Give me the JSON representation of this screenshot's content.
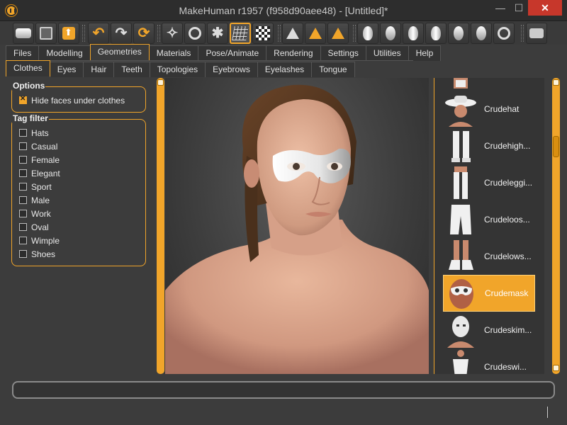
{
  "window": {
    "title": "MakeHuman r1957 (f958d90aee48) - [Untitled]*",
    "minimize_glyph": "—",
    "maximize_glyph": "☐",
    "close_glyph": "✕"
  },
  "toolbar": {
    "icons": [
      "wireframe-toggle-icon",
      "save-icon",
      "export-icon",
      "undo-icon",
      "redo-icon",
      "reset-icon",
      "smooth-icon",
      "wireframe-icon",
      "pose-icon",
      "grid-icon",
      "background-icon",
      "front-view-icon",
      "side-view-icon",
      "back-view-icon",
      "head-icon",
      "egg-icon",
      "face-icon",
      "skull-icon",
      "brain-icon",
      "lungs-icon",
      "ring-icon",
      "camera-icon"
    ],
    "active_icon": "grid-icon"
  },
  "tabs": [
    "Files",
    "Modelling",
    "Geometries",
    "Materials",
    "Pose/Animate",
    "Rendering",
    "Settings",
    "Utilities",
    "Help"
  ],
  "active_tab": "Geometries",
  "subtabs": [
    "Clothes",
    "Eyes",
    "Hair",
    "Teeth",
    "Topologies",
    "Eyebrows",
    "Eyelashes",
    "Tongue"
  ],
  "active_subtab": "Clothes",
  "options": {
    "title": "Options",
    "hide_faces_label": "Hide faces under clothes",
    "hide_faces_checked": true
  },
  "tag_filter": {
    "title": "Tag filter",
    "tags": [
      "Hats",
      "Casual",
      "Female",
      "Elegant",
      "Sport",
      "Male",
      "Work",
      "Oval",
      "Wimple",
      "Shoes"
    ]
  },
  "clothes_list": [
    {
      "label": "Crudehat",
      "selected": false
    },
    {
      "label": "Crudehigh...",
      "selected": false
    },
    {
      "label": "Crudeleggi...",
      "selected": false
    },
    {
      "label": "Crudeloos...",
      "selected": false
    },
    {
      "label": "Crudelows...",
      "selected": false
    },
    {
      "label": "Crudemask",
      "selected": true
    },
    {
      "label": "Crudeskim...",
      "selected": false
    },
    {
      "label": "Crudeswi...",
      "selected": false
    }
  ],
  "colors": {
    "accent": "#f1a52a",
    "background": "#3c3c3c",
    "close_button": "#c7372b"
  }
}
